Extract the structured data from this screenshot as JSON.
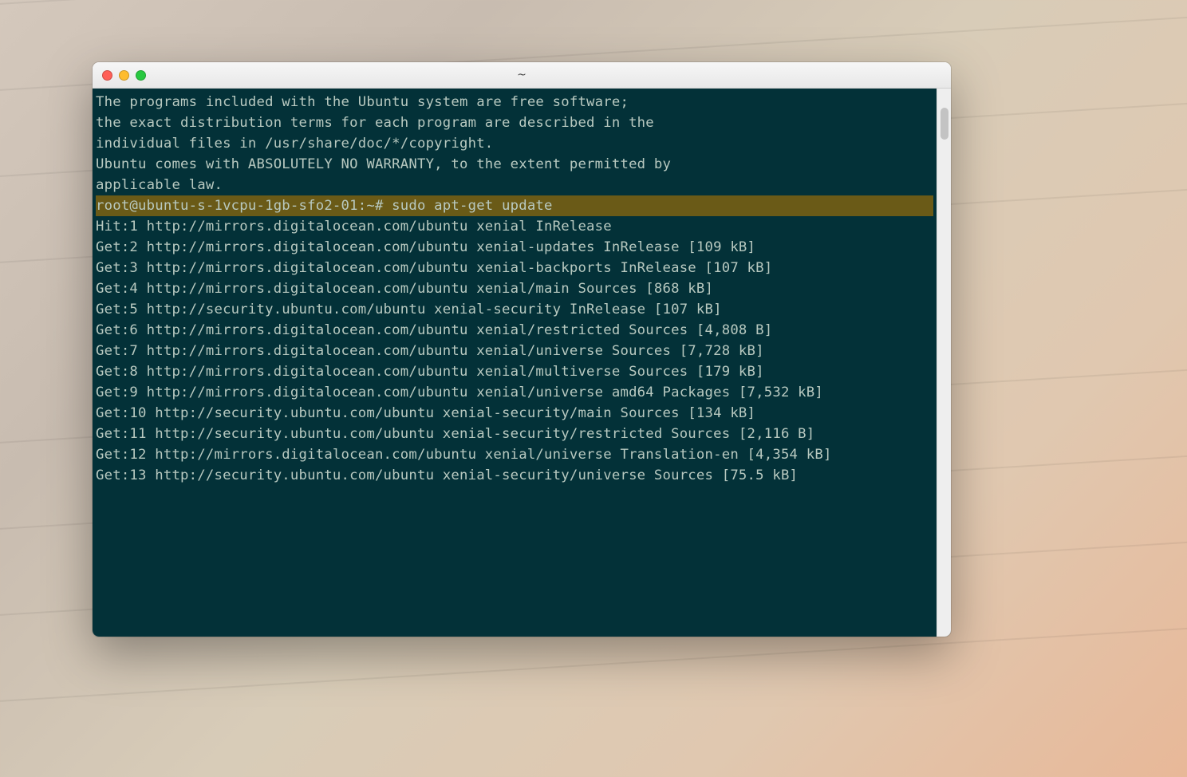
{
  "window": {
    "title": "~"
  },
  "motd": {
    "line1": "The programs included with the Ubuntu system are free software;",
    "line2": "the exact distribution terms for each program are described in the",
    "line3": "individual files in /usr/share/doc/*/copyright.",
    "line4": "",
    "line5": "Ubuntu comes with ABSOLUTELY NO WARRANTY, to the extent permitted by",
    "line6": "applicable law.",
    "line7": ""
  },
  "prompt": {
    "text": "root@ubuntu-s-1vcpu-1gb-sfo2-01:~# ",
    "command": "sudo apt-get update"
  },
  "output": [
    "Hit:1 http://mirrors.digitalocean.com/ubuntu xenial InRelease",
    "Get:2 http://mirrors.digitalocean.com/ubuntu xenial-updates InRelease [109 kB]",
    "Get:3 http://mirrors.digitalocean.com/ubuntu xenial-backports InRelease [107 kB]",
    "Get:4 http://mirrors.digitalocean.com/ubuntu xenial/main Sources [868 kB]",
    "Get:5 http://security.ubuntu.com/ubuntu xenial-security InRelease [107 kB]",
    "Get:6 http://mirrors.digitalocean.com/ubuntu xenial/restricted Sources [4,808 B]",
    "Get:7 http://mirrors.digitalocean.com/ubuntu xenial/universe Sources [7,728 kB]",
    "Get:8 http://mirrors.digitalocean.com/ubuntu xenial/multiverse Sources [179 kB]",
    "Get:9 http://mirrors.digitalocean.com/ubuntu xenial/universe amd64 Packages [7,532 kB]",
    "Get:10 http://security.ubuntu.com/ubuntu xenial-security/main Sources [134 kB]",
    "Get:11 http://security.ubuntu.com/ubuntu xenial-security/restricted Sources [2,116 B]",
    "Get:12 http://mirrors.digitalocean.com/ubuntu xenial/universe Translation-en [4,354 kB]",
    "Get:13 http://security.ubuntu.com/ubuntu xenial-security/universe Sources [75.5 kB]"
  ]
}
